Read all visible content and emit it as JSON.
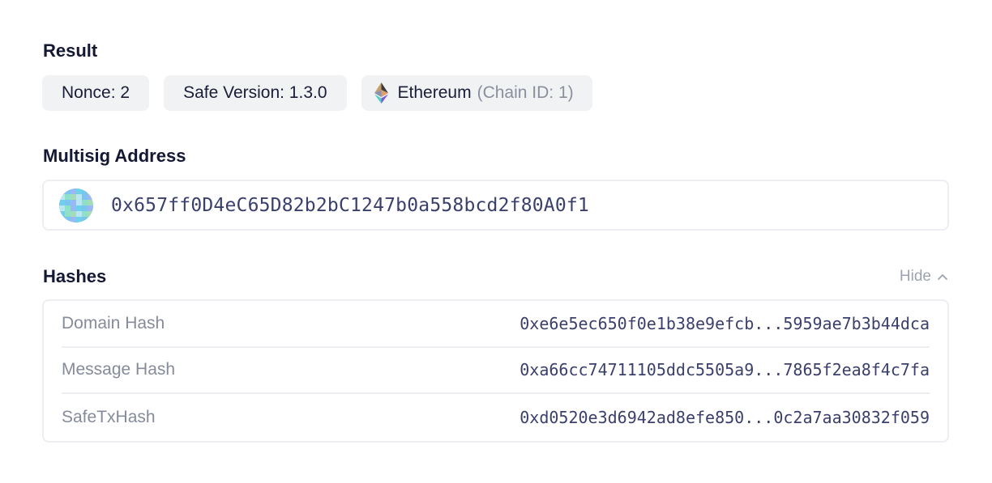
{
  "result": {
    "title": "Result",
    "nonce": "Nonce: 2",
    "safe_version": "Safe Version: 1.3.0",
    "chain_name": "Ethereum",
    "chain_id": "(Chain ID: 1)",
    "chain_icon": "ethereum-icon"
  },
  "multisig": {
    "title": "Multisig Address",
    "address": "0x657ff0D4eC65D82b2bC1247b0a558bcd2f80A0f1",
    "avatar_icon": "identicon-avatar"
  },
  "hashes": {
    "title": "Hashes",
    "toggle_label": "Hide",
    "rows": [
      {
        "label": "Domain Hash",
        "value": "0xe6e5ec650f0e1b38e9efcb...5959ae7b3b44dca"
      },
      {
        "label": "Message Hash",
        "value": "0xa66cc74711105ddc5505a9...7865f2ea8f4c7fa"
      },
      {
        "label": "SafeTxHash",
        "value": "0xd0520e3d6942ad8efe850...0c2a7aa30832f059"
      }
    ]
  },
  "colors": {
    "chip_bg": "#f1f2f4",
    "border": "#eceef1",
    "title": "#141833",
    "muted": "#868b9a",
    "mono_text": "#3a3f6c"
  }
}
